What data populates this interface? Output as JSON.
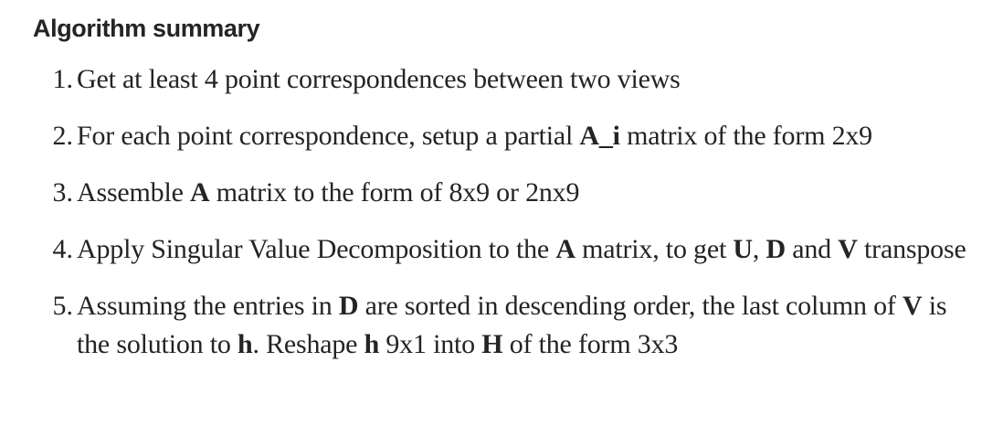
{
  "heading": "Algorithm summary",
  "steps": [
    {
      "number": "1.",
      "segments": [
        {
          "text": "Get at least 4 point correspondences between two views",
          "bold": false
        }
      ]
    },
    {
      "number": "2.",
      "segments": [
        {
          "text": "For each point correspondence, setup a partial ",
          "bold": false
        },
        {
          "text": "A_i",
          "bold": true
        },
        {
          "text": " matrix of the form 2x9",
          "bold": false
        }
      ]
    },
    {
      "number": "3.",
      "segments": [
        {
          "text": "Assemble ",
          "bold": false
        },
        {
          "text": "A",
          "bold": true
        },
        {
          "text": " matrix to the form of 8x9 or 2nx9",
          "bold": false
        }
      ]
    },
    {
      "number": "4.",
      "segments": [
        {
          "text": "Apply Singular Value Decomposition to the ",
          "bold": false
        },
        {
          "text": "A",
          "bold": true
        },
        {
          "text": " matrix, to get ",
          "bold": false
        },
        {
          "text": "U",
          "bold": true
        },
        {
          "text": ", ",
          "bold": false
        },
        {
          "text": "D",
          "bold": true
        },
        {
          "text": " and ",
          "bold": false
        },
        {
          "text": "V",
          "bold": true
        },
        {
          "text": " transpose",
          "bold": false
        }
      ]
    },
    {
      "number": "5.",
      "segments": [
        {
          "text": "Assuming the entries in ",
          "bold": false
        },
        {
          "text": "D",
          "bold": true
        },
        {
          "text": " are sorted in descending order, the last column of ",
          "bold": false
        },
        {
          "text": "V",
          "bold": true
        },
        {
          "text": " is the solution to ",
          "bold": false
        },
        {
          "text": "h",
          "bold": true
        },
        {
          "text": ". Reshape ",
          "bold": false
        },
        {
          "text": "h",
          "bold": true
        },
        {
          "text": " 9x1 into ",
          "bold": false
        },
        {
          "text": "H",
          "bold": true
        },
        {
          "text": " of the form 3x3",
          "bold": false
        }
      ]
    }
  ]
}
